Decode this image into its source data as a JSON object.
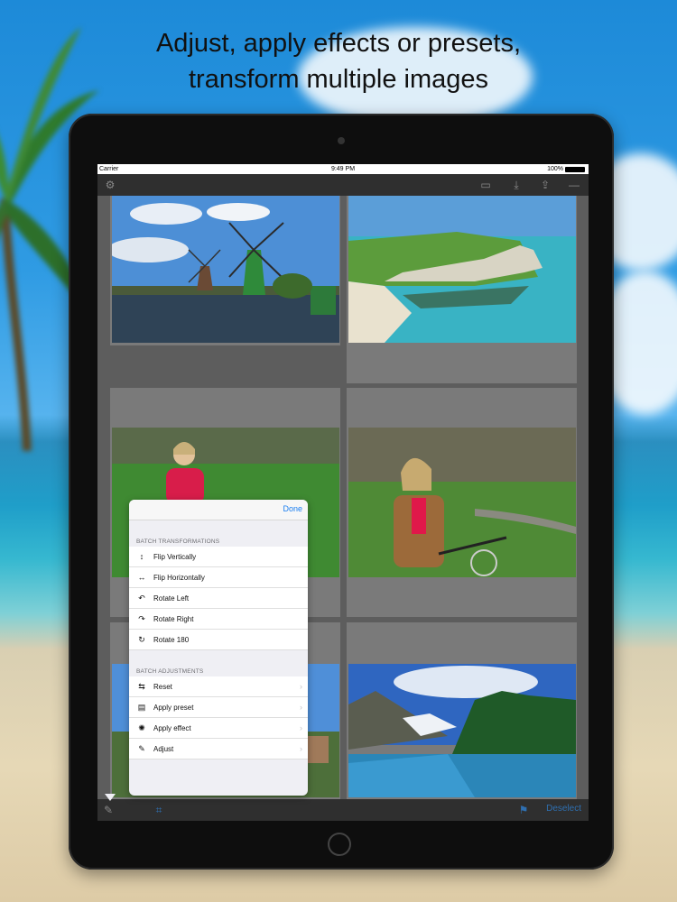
{
  "headline": {
    "line1": "Adjust, apply effects or presets,",
    "line2": "transform multiple images"
  },
  "status_bar": {
    "carrier": "Carrier",
    "time": "9:49 PM",
    "battery": "100%"
  },
  "toolbar": {
    "icons": [
      "gear-icon",
      "screen-icon",
      "download-icon",
      "share-icon",
      "minus-icon"
    ]
  },
  "popover": {
    "done_label": "Done",
    "section1": "BATCH TRANSFORMATIONS",
    "transformations": [
      {
        "label": "Flip Vertically",
        "icon": "flip-vertical-icon"
      },
      {
        "label": "Flip Horizontally",
        "icon": "flip-horizontal-icon"
      },
      {
        "label": "Rotate Left",
        "icon": "rotate-left-icon"
      },
      {
        "label": "Rotate Right",
        "icon": "rotate-right-icon"
      },
      {
        "label": "Rotate 180",
        "icon": "rotate-180-icon"
      }
    ],
    "section2": "BATCH ADJUSTMENTS",
    "adjustments": [
      {
        "label": "Reset",
        "icon": "reset-icon"
      },
      {
        "label": "Apply preset",
        "icon": "preset-icon"
      },
      {
        "label": "Apply effect",
        "icon": "effect-icon"
      },
      {
        "label": "Adjust",
        "icon": "wrench-icon"
      }
    ]
  },
  "bottom_bar": {
    "deselect_label": "Deselect"
  },
  "colors": {
    "accent": "#1a7ef0",
    "toolbar": "#2f2f2f",
    "grid": "#5d5d5d"
  }
}
